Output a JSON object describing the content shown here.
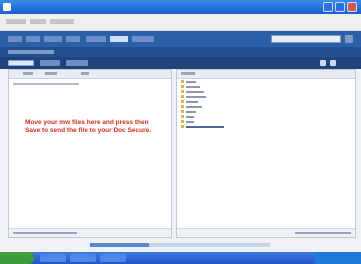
{
  "window": {
    "title": ""
  },
  "left_pane": {
    "instructions": "Move your mw files here and press then Save to send the file to your Doc Secure."
  },
  "status": {
    "progress_fraction": 0.33
  }
}
